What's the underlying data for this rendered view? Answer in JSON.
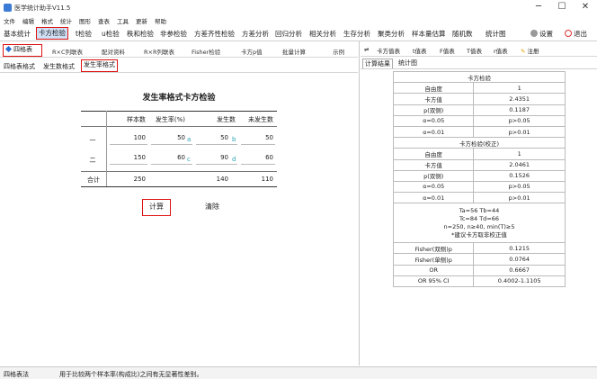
{
  "window": {
    "title": "医学统计助手V11.5",
    "minimize": "─",
    "maximize": "☐",
    "close": "✕"
  },
  "menu": [
    "文件",
    "编辑",
    "格式",
    "统计",
    "图形",
    "查表",
    "工具",
    "更新",
    "帮助"
  ],
  "toolbar": {
    "items": [
      "基本统计",
      "卡方检验",
      "t检验",
      "u检验",
      "秩和检验",
      "非参检验",
      "方差齐性检验",
      "方差分析",
      "回归分析",
      "相关分析",
      "生存分析",
      "聚类分析",
      "样本量估算",
      "随机数",
      "统计图"
    ],
    "active": "卡方检验",
    "settings": "设置",
    "exit": "退出"
  },
  "subtabs": {
    "active": "四格表",
    "items": [
      "R×C列联表",
      "配对资料",
      "R×R列联表",
      "Fisher检验",
      "卡方p值",
      "批量计算",
      "示例"
    ]
  },
  "format_tabs": {
    "items": [
      "四格表格式",
      "发生数格式",
      "发生率格式"
    ],
    "active": "发生率格式"
  },
  "table": {
    "title": "发生率格式卡方检验",
    "headers": [
      "样本数",
      "发生率(%)",
      "发生数",
      "未发生数"
    ],
    "rows": [
      {
        "label": "一",
        "sample": "100",
        "rate": "50",
        "rate_tag": "a",
        "count": "50",
        "count_tag": "b",
        "non": "50"
      },
      {
        "label": "二",
        "sample": "150",
        "rate": "60",
        "rate_tag": "c",
        "count": "90",
        "count_tag": "d",
        "non": "60"
      },
      {
        "label": "合计",
        "sample": "250",
        "rate": "",
        "rate_tag": "",
        "count": "140",
        "count_tag": "",
        "non": "110"
      }
    ],
    "calc_button": "计算",
    "clear_button": "清除"
  },
  "right_toolbar": {
    "items": [
      "卡方值表",
      "t值表",
      "F值表",
      "T值表",
      "r值表",
      "注册"
    ]
  },
  "result_tabs": {
    "items": [
      "计算结果",
      "统计图"
    ],
    "active": "计算结果"
  },
  "results": {
    "chi_title": "卡方检验",
    "chi_rows": [
      [
        "自由度",
        "1"
      ],
      [
        "卡方值",
        "2.4351"
      ],
      [
        "p(双侧)",
        "0.1187"
      ],
      [
        "α=0.05",
        "p>0.05"
      ],
      [
        "α=0.01",
        "p>0.01"
      ]
    ],
    "corr_title": "卡方检验(校正)",
    "corr_rows": [
      [
        "自由度",
        "1"
      ],
      [
        "卡方值",
        "2.0461"
      ],
      [
        "p(双侧)",
        "0.1526"
      ],
      [
        "α=0.05",
        "p>0.05"
      ],
      [
        "α=0.01",
        "p>0.01"
      ]
    ],
    "note_lines": [
      "Ta=56    Tb=44",
      "Tc=84    Td=66",
      "n=250, n≥40, min(T)≥5",
      "*建议卡方取非校正值"
    ],
    "extra_rows": [
      [
        "Fisher(双侧)p",
        "0.1215"
      ],
      [
        "Fisher(单侧)p",
        "0.0764"
      ],
      [
        "OR",
        "0.6667"
      ],
      [
        "OR 95% CI",
        "0.4002-1.1105"
      ]
    ]
  },
  "status": {
    "left": "四格表法",
    "message": "用于比较两个样本率(构成比)之间有无显著性差别。"
  }
}
